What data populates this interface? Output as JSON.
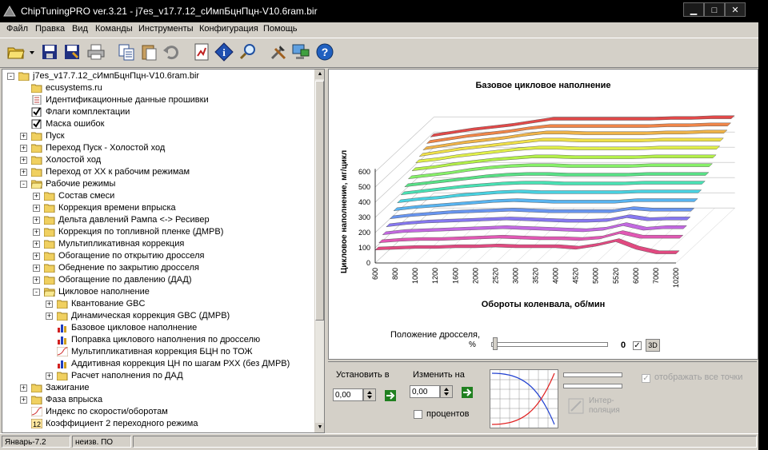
{
  "window": {
    "title": "ChipTuningPRO ver.3.21 - j7es_v17.7.12_сИмпБцнПцн-V10.6ram.bir",
    "minimize": "▁",
    "maximize": "□",
    "close": "✕"
  },
  "menu": [
    "Файл",
    "Правка",
    "Вид",
    "Команды",
    "Инструменты",
    "Конфигурация",
    "Помощь"
  ],
  "toolbar": {
    "icons": [
      "open-icon",
      "dropdown-arrow-icon",
      "save-icon",
      "save-as-icon",
      "print-icon",
      "copy-icon",
      "paste-icon",
      "undo-icon",
      "checksum-icon",
      "info-icon",
      "search-icon",
      "tools-icon",
      "connect-icon",
      "help-icon"
    ]
  },
  "tree": {
    "root": "j7es_v17.7.12_сИмпБцнПцн-V10.6ram.bir",
    "items": [
      {
        "label": "ecusystems.ru",
        "level": 1,
        "icon": "folder",
        "expander": ""
      },
      {
        "label": "Идентификационные данные прошивки",
        "level": 1,
        "icon": "doc",
        "expander": ""
      },
      {
        "label": "Флаги комплектации",
        "level": 1,
        "icon": "check",
        "expander": ""
      },
      {
        "label": "Маска ошибок",
        "level": 1,
        "icon": "check",
        "expander": ""
      },
      {
        "label": "Пуск",
        "level": 1,
        "icon": "folder",
        "expander": "+"
      },
      {
        "label": "Переход Пуск - Холостой ход",
        "level": 1,
        "icon": "folder",
        "expander": "+"
      },
      {
        "label": "Холостой ход",
        "level": 1,
        "icon": "folder",
        "expander": "+"
      },
      {
        "label": "Переход от ХХ к рабочим режимам",
        "level": 1,
        "icon": "folder",
        "expander": "+"
      },
      {
        "label": "Рабочие режимы",
        "level": 1,
        "icon": "folder-open",
        "expander": "-"
      },
      {
        "label": "Состав смеси",
        "level": 2,
        "icon": "folder",
        "expander": "+"
      },
      {
        "label": "Коррекция времени впрыска",
        "level": 2,
        "icon": "folder",
        "expander": "+"
      },
      {
        "label": "Дельта давлений Рампа <-> Ресивер",
        "level": 2,
        "icon": "folder",
        "expander": "+"
      },
      {
        "label": "Коррекция по топливной пленке (ДМРВ)",
        "level": 2,
        "icon": "folder",
        "expander": "+"
      },
      {
        "label": "Мультипликативная коррекция",
        "level": 2,
        "icon": "folder",
        "expander": "+"
      },
      {
        "label": "Обогащение по открытию дросселя",
        "level": 2,
        "icon": "folder",
        "expander": "+"
      },
      {
        "label": "Обеднение по закрытию дросселя",
        "level": 2,
        "icon": "folder",
        "expander": "+"
      },
      {
        "label": "Обогащение по давлению (ДАД)",
        "level": 2,
        "icon": "folder",
        "expander": "+"
      },
      {
        "label": "Цикловое наполнение",
        "level": 2,
        "icon": "folder-open",
        "expander": "-"
      },
      {
        "label": "Квантование GBC",
        "level": 3,
        "icon": "folder",
        "expander": "+"
      },
      {
        "label": "Динамическая коррекция GBC (ДМРВ)",
        "level": 3,
        "icon": "folder",
        "expander": "+"
      },
      {
        "label": "Базовое цикловое наполнение",
        "level": 3,
        "icon": "chart",
        "expander": ""
      },
      {
        "label": "Поправка циклового наполнения по дросселю",
        "level": 3,
        "icon": "chart",
        "expander": ""
      },
      {
        "label": "Мультипликативная коррекция БЦН по ТОЖ",
        "level": 3,
        "icon": "curve",
        "expander": ""
      },
      {
        "label": "Аддитивная коррекция ЦН по шагам РХХ (без ДМРВ)",
        "level": 3,
        "icon": "chart",
        "expander": ""
      },
      {
        "label": "Расчет наполнения по ДАД",
        "level": 3,
        "icon": "folder",
        "expander": "+"
      },
      {
        "label": "Зажигание",
        "level": 1,
        "icon": "folder",
        "expander": "+"
      },
      {
        "label": "Фаза впрыска",
        "level": 1,
        "icon": "folder",
        "expander": "+"
      },
      {
        "label": "Индекс по скорости/оборотам",
        "level": 1,
        "icon": "curve",
        "expander": ""
      },
      {
        "label": "Коэффициент 2 переходного режима",
        "level": 1,
        "icon": "num12",
        "expander": ""
      }
    ]
  },
  "chart_data": {
    "type": "surface",
    "title": "Базовое цикловое наполнение",
    "xlabel": "Обороты коленвала, об/мин",
    "ylabel": "Цикловое наполнение, мг/цикл",
    "x_ticks": [
      "600",
      "800",
      "1000",
      "1200",
      "1600",
      "2000",
      "2520",
      "3000",
      "3520",
      "4000",
      "4520",
      "5000",
      "5520",
      "6000",
      "7000",
      "10200"
    ],
    "z_ticks": [
      "0",
      "100",
      "200",
      "300",
      "400",
      "500",
      "600"
    ],
    "zlim": [
      0,
      650
    ],
    "series_count": 16,
    "series": [
      {
        "values": [
          85,
          90,
          95,
          95,
          100,
          100,
          105,
          100,
          100,
          100,
          90,
          110,
          140,
          90,
          60,
          60
        ]
      },
      {
        "values": [
          110,
          120,
          125,
          125,
          130,
          135,
          140,
          135,
          130,
          130,
          125,
          135,
          170,
          140,
          140,
          140
        ]
      },
      {
        "values": [
          140,
          155,
          160,
          165,
          170,
          175,
          180,
          175,
          170,
          165,
          160,
          170,
          200,
          170,
          180,
          180
        ]
      },
      {
        "values": [
          170,
          185,
          195,
          200,
          205,
          210,
          215,
          210,
          205,
          200,
          200,
          205,
          230,
          210,
          215,
          215
        ]
      },
      {
        "values": [
          200,
          215,
          225,
          235,
          240,
          245,
          250,
          245,
          240,
          240,
          240,
          240,
          260,
          250,
          250,
          250
        ]
      },
      {
        "values": [
          230,
          245,
          255,
          265,
          275,
          285,
          290,
          285,
          280,
          280,
          280,
          280,
          290,
          290,
          290,
          290
        ]
      },
      {
        "values": [
          260,
          275,
          285,
          300,
          310,
          320,
          325,
          320,
          320,
          320,
          320,
          320,
          325,
          325,
          325,
          325
        ]
      },
      {
        "values": [
          290,
          305,
          320,
          335,
          345,
          355,
          360,
          360,
          355,
          355,
          355,
          355,
          360,
          360,
          360,
          360
        ]
      },
      {
        "values": [
          320,
          335,
          350,
          365,
          380,
          390,
          395,
          395,
          390,
          390,
          390,
          390,
          395,
          395,
          395,
          395
        ]
      },
      {
        "values": [
          350,
          365,
          380,
          400,
          415,
          425,
          430,
          430,
          425,
          425,
          425,
          425,
          430,
          430,
          430,
          430
        ]
      },
      {
        "values": [
          380,
          395,
          415,
          430,
          445,
          455,
          465,
          465,
          460,
          460,
          460,
          460,
          465,
          465,
          465,
          465
        ]
      },
      {
        "values": [
          410,
          425,
          445,
          460,
          475,
          490,
          500,
          500,
          495,
          495,
          495,
          495,
          500,
          500,
          500,
          500
        ]
      },
      {
        "values": [
          430,
          450,
          470,
          485,
          500,
          515,
          530,
          530,
          525,
          525,
          525,
          525,
          530,
          530,
          530,
          530
        ]
      },
      {
        "values": [
          450,
          470,
          490,
          505,
          520,
          540,
          555,
          555,
          550,
          550,
          550,
          550,
          555,
          555,
          560,
          560
        ]
      },
      {
        "values": [
          470,
          490,
          510,
          525,
          540,
          560,
          575,
          575,
          575,
          575,
          575,
          575,
          580,
          580,
          585,
          585
        ]
      },
      {
        "values": [
          490,
          510,
          530,
          545,
          560,
          580,
          600,
          600,
          600,
          600,
          600,
          600,
          605,
          605,
          610,
          610
        ]
      }
    ],
    "grid": true,
    "colormap": [
      "#e0407a",
      "#e050b0",
      "#c060e0",
      "#8070f0",
      "#6090f0",
      "#50b0f0",
      "#40d0e0",
      "#40e0b0",
      "#50e080",
      "#80f060",
      "#b0f040",
      "#e0f040",
      "#f0e040",
      "#f0b040",
      "#f08040",
      "#e04040"
    ]
  },
  "throttle": {
    "label": "Положение дросселя,",
    "unit": "%",
    "value": "0",
    "value_fraction": 0,
    "btn3d_label": "3D",
    "check_3d": "✓"
  },
  "controls": {
    "set_label": "Установить в",
    "set_value": "0,00",
    "change_label": "Изменить на",
    "change_value": "0,00",
    "percent_label": "процентов",
    "interp_label": "Интер-\nполяция",
    "show_points_label": "отображать все точки",
    "show_points_check": "✓"
  },
  "status": {
    "cell1": "Январь-7.2",
    "cell2": "неизв. ПО"
  }
}
